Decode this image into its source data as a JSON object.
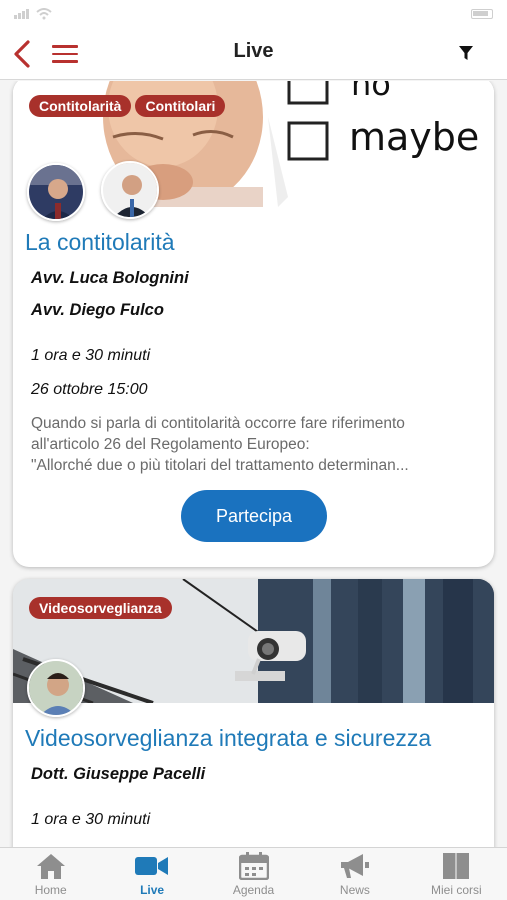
{
  "header": {
    "title": "Live"
  },
  "cards": [
    {
      "tags": [
        "Contitolarità",
        "Contitolari"
      ],
      "hero_text": [
        "no",
        "maybe"
      ],
      "title": "La contitolarità",
      "speakers": [
        "Avv. Luca Bolognini",
        "Avv. Diego Fulco"
      ],
      "duration": "1 ora e 30 minuti",
      "date": "26 ottobre 15:00",
      "description": [
        "Quando si parla di contitolarità occorre fare riferimento",
        "all'articolo 26 del Regolamento Europeo:",
        "\"Allorché due o più titolari del trattamento determinan..."
      ],
      "button_label": "Partecipa"
    },
    {
      "tags": [
        "Videosorveglianza"
      ],
      "title": "Videosorveglianza integrata e sicurezza",
      "speakers": [
        "Dott. Giuseppe Pacelli"
      ],
      "duration": "1 ora e 30 minuti"
    }
  ],
  "tabbar": {
    "items": [
      {
        "label": "Home",
        "icon": "home-icon",
        "active": false
      },
      {
        "label": "Live",
        "icon": "video-camera-icon",
        "active": true
      },
      {
        "label": "Agenda",
        "icon": "calendar-icon",
        "active": false
      },
      {
        "label": "News",
        "icon": "megaphone-icon",
        "active": false
      },
      {
        "label": "Miei corsi",
        "icon": "book-icon",
        "active": false
      }
    ]
  },
  "colors": {
    "accent_red": "#a8312b",
    "accent_blue": "#1a72bf",
    "title_blue": "#1f7ab8"
  }
}
